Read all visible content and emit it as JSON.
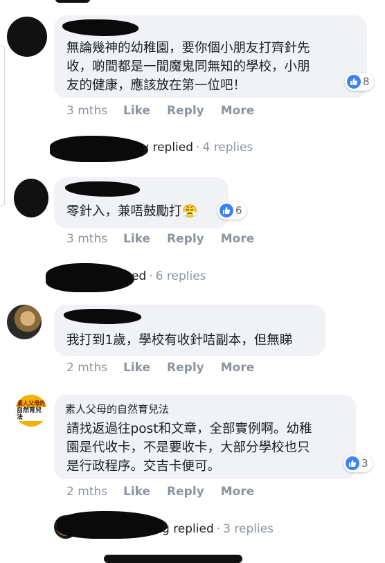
{
  "comments": [
    {
      "text_lines": [
        "無論幾神的幼稚園，要你個小朋友打齊針先",
        "收，啲間都是一間魔鬼同無知的學校，小朋",
        "友的健康，應該放在第一位吧！"
      ],
      "reaction_count": "8",
      "time": "3 mths",
      "like": "Like",
      "reply": "Reply",
      "more": "More",
      "replies_label": "y replied",
      "replies_count": "4 replies"
    },
    {
      "text_lines": [
        "零針入，兼唔鼓勵打"
      ],
      "emoji": "😤",
      "reaction_count": "6",
      "time": "3 mths",
      "like": "Like",
      "reply": "Reply",
      "more": "More",
      "replies_label": "ed",
      "replies_count": "6 replies"
    },
    {
      "text_lines": [
        "我打到1歲，學校有收針咭副本，但無睇"
      ],
      "time": "2 mths",
      "like": "Like",
      "reply": "Reply",
      "more": "More"
    },
    {
      "name": "素人父母的自然育兒法",
      "avatar_text": [
        "素人父母的",
        "自然育兒法"
      ],
      "text_lines": [
        "請找返過往post和文章，全部實例啊。幼稚",
        "園是代收卡，不是要收卡，大部分學校也只",
        "是行政程序。交吉卡便可。"
      ],
      "reaction_count": "3",
      "time": "2 mths",
      "like": "Like",
      "reply": "Reply",
      "more": "More",
      "replies_label": "g replied",
      "replies_count": "3 replies"
    }
  ],
  "separator": "·",
  "colors": {
    "like_blue": "#3b82f6",
    "bubble_bg": "#f0f2f5",
    "meta_gray": "#8d949e"
  },
  "icons": {
    "reaction": "like-thumb-icon"
  }
}
